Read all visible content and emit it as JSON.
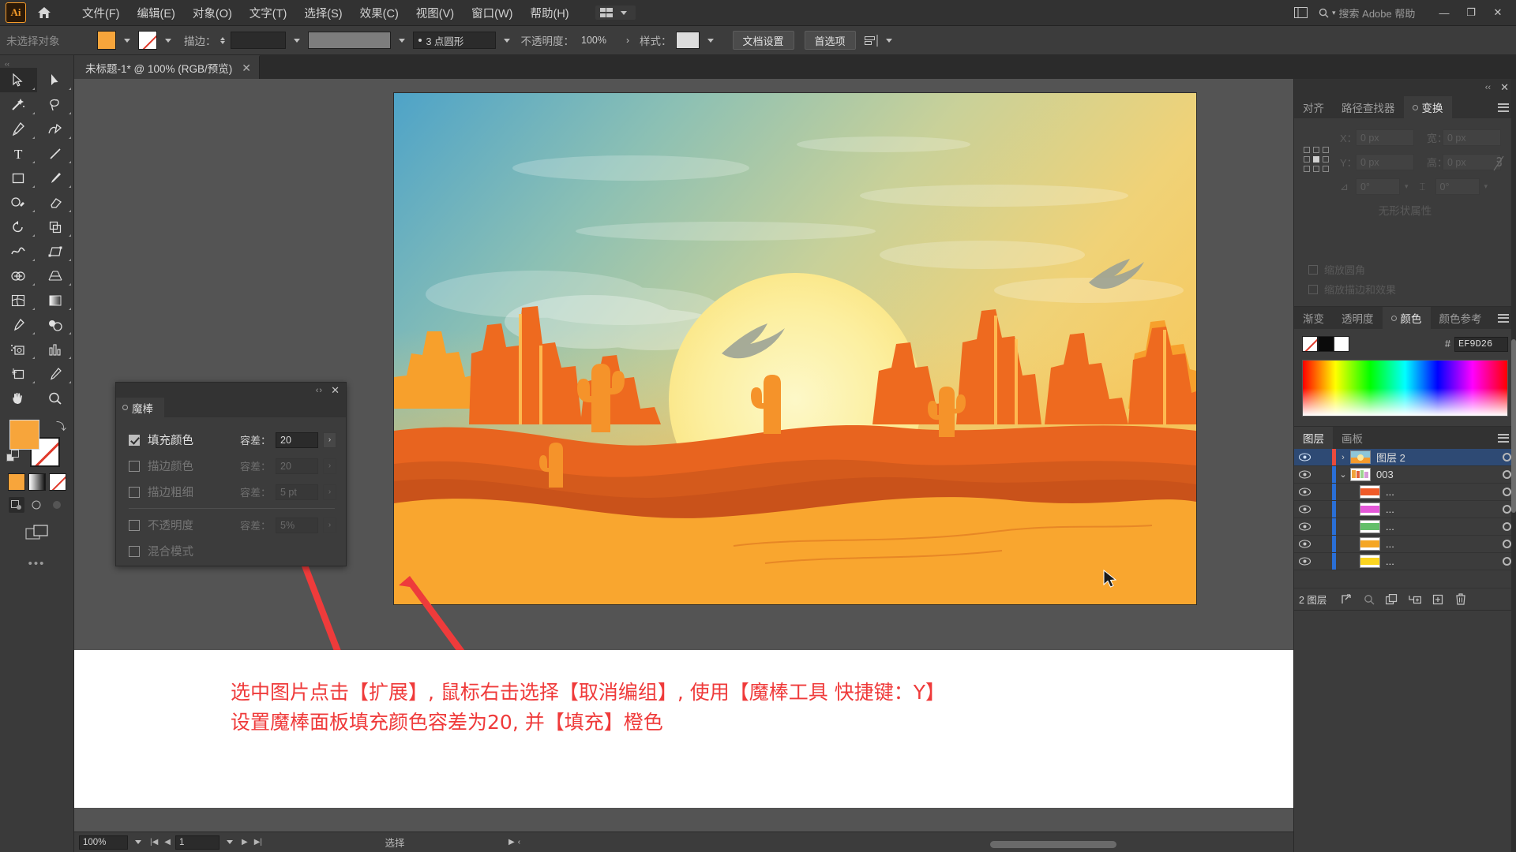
{
  "app": {
    "logo_text": "Ai",
    "menus": [
      "文件(F)",
      "编辑(E)",
      "对象(O)",
      "文字(T)",
      "选择(S)",
      "效果(C)",
      "视图(V)",
      "窗口(W)",
      "帮助(H)"
    ],
    "search_placeholder": "搜索 Adobe 帮助",
    "window_buttons": [
      "—",
      "❐",
      "✕"
    ]
  },
  "control_bar": {
    "selection_label": "未选择对象",
    "stroke_label": "描边：",
    "stroke_weight": "",
    "brush_label": "3 点圆形",
    "opacity_label": "不透明度：",
    "opacity_value": "100%",
    "style_label": "样式：",
    "doc_setup_button": "文档设置",
    "preferences_button": "首选项"
  },
  "document_tab": {
    "title": "未标题-1* @ 100% (RGB/预览)",
    "close": "✕"
  },
  "toolbar": {
    "tools": [
      "selection-tool",
      "direct-selection-tool",
      "magic-wand-tool",
      "lasso-tool",
      "pen-tool",
      "curvature-tool",
      "type-tool",
      "line-segment-tool",
      "rectangle-tool",
      "paintbrush-tool",
      "shaper-tool",
      "eraser-tool",
      "rotate-tool",
      "scale-tool",
      "width-tool",
      "free-transform-tool",
      "shape-builder-tool",
      "perspective-grid-tool",
      "mesh-tool",
      "gradient-tool",
      "eyedropper-tool",
      "blend-tool",
      "symbol-sprayer-tool",
      "column-graph-tool",
      "artboard-tool",
      "slice-tool",
      "hand-tool",
      "zoom-tool"
    ],
    "fill_color": "#F7A53B",
    "stroke_color": "none",
    "more_tools": "•••"
  },
  "magic_wand_panel": {
    "title": "魔棒",
    "close": "✕",
    "dots": "‹›",
    "rows": [
      {
        "label": "填充颜色",
        "checked": true,
        "tolerance_label": "容差：",
        "tolerance_value": "20",
        "enabled": true
      },
      {
        "label": "描边颜色",
        "checked": false,
        "tolerance_label": "容差：",
        "tolerance_value": "20",
        "enabled": false
      },
      {
        "label": "描边粗细",
        "checked": false,
        "tolerance_label": "容差：",
        "tolerance_value": "5 pt",
        "enabled": false
      },
      {
        "label": "不透明度",
        "checked": false,
        "tolerance_label": "容差：",
        "tolerance_value": "5%",
        "enabled": false
      },
      {
        "label": "混合模式",
        "checked": false,
        "tolerance_label": "",
        "tolerance_value": "",
        "enabled": false
      }
    ]
  },
  "transform_panel": {
    "tabs": [
      {
        "label": "对齐",
        "active": false,
        "dot": false
      },
      {
        "label": "路径查找器",
        "active": false,
        "dot": false
      },
      {
        "label": "变换",
        "active": true,
        "dot": true
      }
    ],
    "fields": [
      {
        "label": "X：",
        "value": "0 px"
      },
      {
        "label": "宽：",
        "value": "0 px"
      },
      {
        "label": "Y：",
        "value": "0 px"
      },
      {
        "label": "高：",
        "value": "0 px"
      }
    ],
    "angle_value": "0°",
    "shear_value": "0°",
    "empty_text": "无形状属性",
    "checkboxes": [
      "缩放圆角",
      "缩放描边和效果"
    ]
  },
  "color_panel": {
    "tabs": [
      {
        "label": "渐变",
        "active": false,
        "dot": false
      },
      {
        "label": "透明度",
        "active": false,
        "dot": false
      },
      {
        "label": "颜色",
        "active": true,
        "dot": true
      },
      {
        "label": "颜色参考",
        "active": false,
        "dot": false
      }
    ],
    "hash": "#",
    "hex_value": "EF9D26"
  },
  "layers_panel": {
    "tabs": [
      {
        "label": "图层",
        "active": true
      },
      {
        "label": "画板",
        "active": false
      }
    ],
    "rows": [
      {
        "name": "图层 2",
        "selected": true,
        "indent": 0,
        "expand": "›",
        "color": "#ea4b3c",
        "thumb": "sunset",
        "eye": true
      },
      {
        "name": "003",
        "selected": false,
        "indent": 0,
        "expand": "⌄",
        "color": "#2a6fd6",
        "thumb": "multi",
        "eye": true
      },
      {
        "name": "...",
        "selected": false,
        "indent": 1,
        "expand": "",
        "color": "#2a6fd6",
        "thumb": "orange",
        "eye": true
      },
      {
        "name": "...",
        "selected": false,
        "indent": 1,
        "expand": "",
        "color": "#2a6fd6",
        "thumb": "magenta",
        "eye": true
      },
      {
        "name": "...",
        "selected": false,
        "indent": 1,
        "expand": "",
        "color": "#2a6fd6",
        "thumb": "green",
        "eye": true
      },
      {
        "name": "...",
        "selected": false,
        "indent": 1,
        "expand": "",
        "color": "#2a6fd6",
        "thumb": "amber",
        "eye": true
      },
      {
        "name": "...",
        "selected": false,
        "indent": 1,
        "expand": "",
        "color": "#2a6fd6",
        "thumb": "yellow",
        "eye": true
      }
    ],
    "footer_count": "2 图层",
    "footer_icons": [
      "locate-object-icon",
      "search-icon",
      "make-clipping-mask-icon",
      "new-sublayer-icon",
      "new-layer-icon",
      "delete-layer-icon"
    ]
  },
  "status_bar": {
    "zoom": "100%",
    "page": "1",
    "status_text": "选择"
  },
  "caption": {
    "line1": "选中图片点击【扩展】, 鼠标右击选择【取消编组】, 使用【魔棒工具 快捷键：Y】",
    "line2": "设置魔棒面板填充颜色容差为20, 并【填充】橙色",
    "color": "#EF3A3A"
  },
  "artwork": {
    "title": "desert-sunset-illustration",
    "colors": {
      "sky_top": "#4ea3c8",
      "sky_mid": "#a7c9a8",
      "sky_low": "#f0d277",
      "sun": "#fdf3b0",
      "sun_outer": "#fbe98c",
      "mesa_dark": "#e8641f",
      "mesa_light": "#f7a02c",
      "dune_mid": "#c9521a",
      "dune_front": "#f9a62f",
      "cactus": "#f5932a",
      "bird": "#9a9f92"
    }
  }
}
